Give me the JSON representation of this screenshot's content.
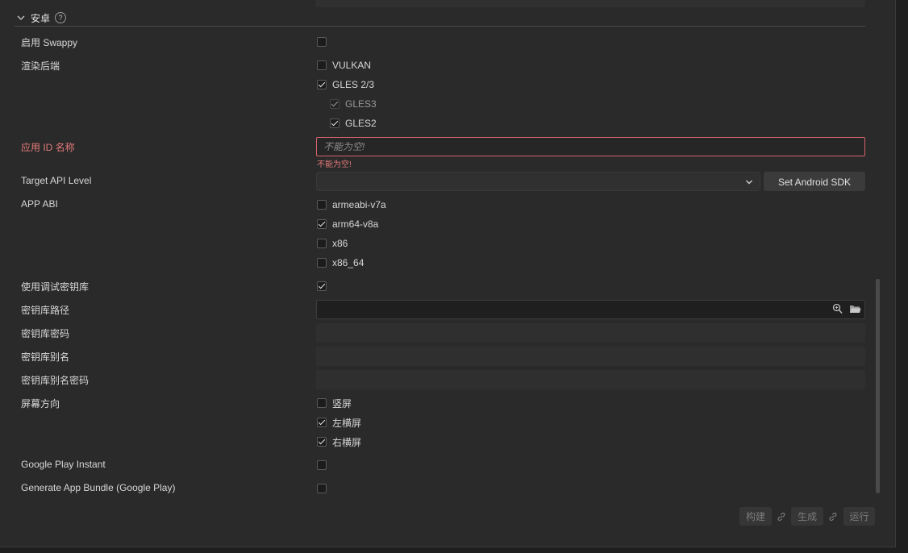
{
  "top_cut": {
    "label": ""
  },
  "section": {
    "title": "安卓",
    "help_icon": "?"
  },
  "rows": {
    "swappy": {
      "label": "启用 Swappy",
      "checked": false
    },
    "render_backend": {
      "label": "渲染后端",
      "options": [
        {
          "label": "VULKAN",
          "checked": false
        },
        {
          "label": "GLES 2/3",
          "checked": true
        },
        {
          "label": "GLES3",
          "checked": true,
          "disabled": true
        },
        {
          "label": "GLES2",
          "checked": true
        }
      ]
    },
    "app_id": {
      "label": "应用 ID 名称",
      "placeholder": "不能为空!",
      "error": "不能为空!"
    },
    "target_api": {
      "label": "Target API Level",
      "value": "",
      "button": "Set Android SDK"
    },
    "app_abi": {
      "label": "APP ABI",
      "options": [
        {
          "label": "armeabi-v7a",
          "checked": false
        },
        {
          "label": "arm64-v8a",
          "checked": true
        },
        {
          "label": "x86",
          "checked": false
        },
        {
          "label": "x86_64",
          "checked": false
        }
      ]
    },
    "use_debug_keystore": {
      "label": "使用调试密钥库",
      "checked": true
    },
    "keystore_path": {
      "label": "密钥库路径",
      "value": ""
    },
    "keystore_password": {
      "label": "密钥库密码",
      "value": ""
    },
    "keystore_alias": {
      "label": "密钥库别名",
      "value": ""
    },
    "keystore_alias_password": {
      "label": "密钥库别名密码",
      "value": ""
    },
    "orientation": {
      "label": "屏幕方向",
      "options": [
        {
          "label": "竖屏",
          "checked": false
        },
        {
          "label": "左横屏",
          "checked": true
        },
        {
          "label": "右横屏",
          "checked": true
        }
      ]
    },
    "google_play_instant": {
      "label": "Google Play Instant",
      "checked": false
    },
    "app_bundle": {
      "label": "Generate App Bundle (Google Play)",
      "checked": false
    }
  },
  "actions": {
    "build": "构建",
    "make": "生成",
    "run": "运行"
  },
  "icons": {
    "chevron": "chevron-down-icon",
    "help": "help-circle-icon",
    "search": "search-icon",
    "folder": "folder-icon",
    "link": "link-icon",
    "dropdown": "chevron-down-icon"
  },
  "colors": {
    "panel": "#2a2a2a",
    "error": "#e47a7a",
    "input_bg": "#1f1f1f"
  }
}
